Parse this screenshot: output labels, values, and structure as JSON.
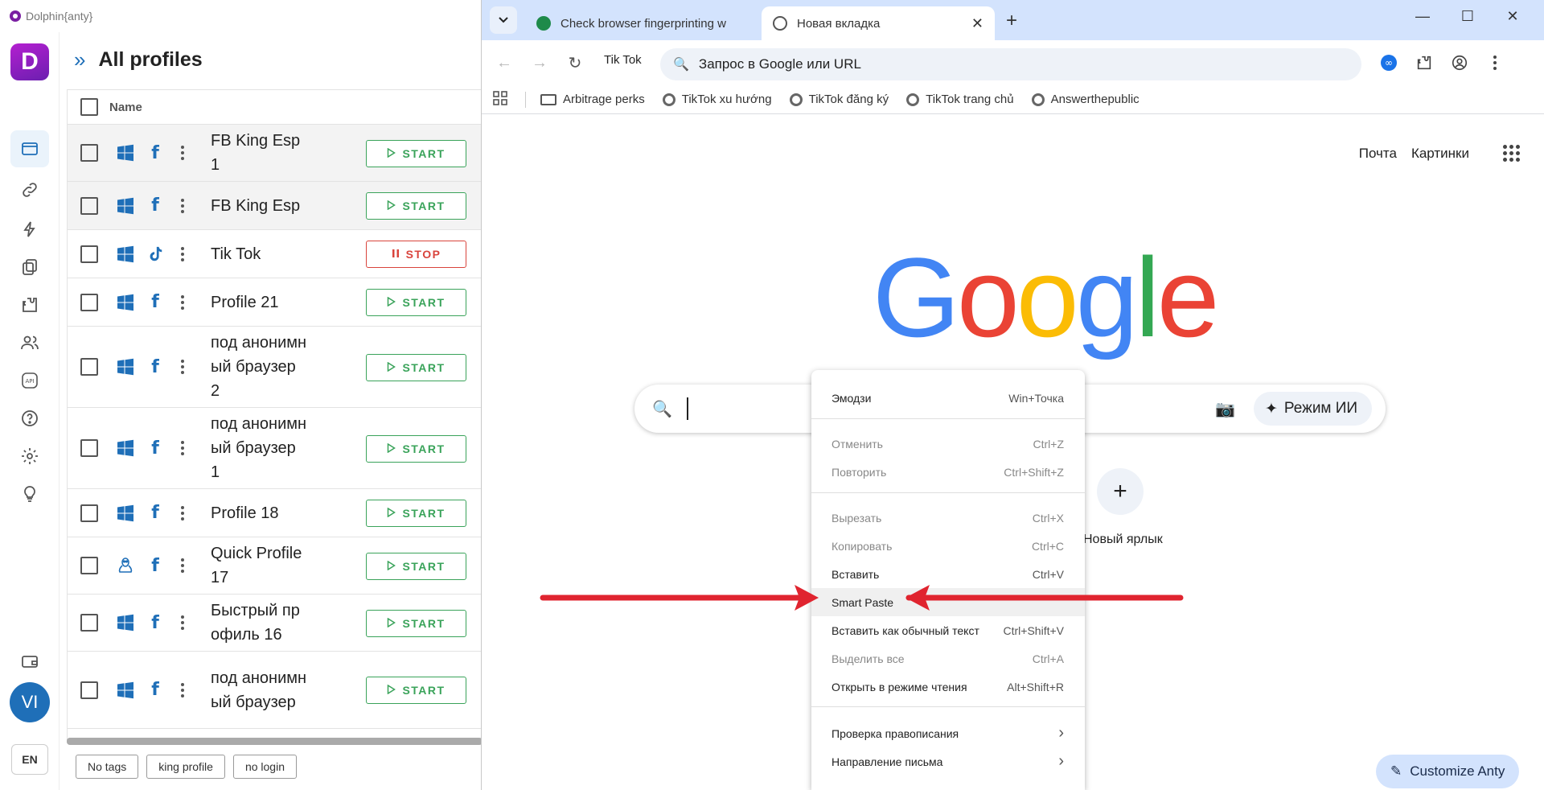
{
  "dolphin": {
    "app_title": "Dolphin{anty}",
    "logo_letter": "D",
    "page_title": "All profiles",
    "column_name": "Name",
    "avatar_initials": "VI",
    "language": "EN",
    "profiles": [
      {
        "name": "FB King Esp 1",
        "os": "windows",
        "app": "f",
        "action": "START"
      },
      {
        "name": "FB King Esp",
        "os": "windows",
        "app": "f",
        "action": "START"
      },
      {
        "name": "Tik Tok",
        "os": "windows",
        "app": "tiktok",
        "action": "STOP"
      },
      {
        "name": "Profile 21",
        "os": "windows",
        "app": "f",
        "action": "START"
      },
      {
        "name": "под анонимный браузер 2",
        "os": "windows",
        "app": "f",
        "action": "START"
      },
      {
        "name": "под анонимный браузер 1",
        "os": "windows",
        "app": "f",
        "action": "START"
      },
      {
        "name": "Profile 18",
        "os": "windows",
        "app": "f",
        "action": "START"
      },
      {
        "name": "Quick Profile 17",
        "os": "linux",
        "app": "f",
        "action": "START"
      },
      {
        "name": "Быстрый профиль 16",
        "os": "windows",
        "app": "f",
        "action": "START"
      },
      {
        "name": "под анонимный браузер",
        "os": "windows",
        "app": "f",
        "action": "START"
      }
    ],
    "tags": [
      "No tags",
      "king profile",
      "no login"
    ]
  },
  "chrome": {
    "tabs": [
      {
        "title": "Check browser fingerprinting w",
        "active": false
      },
      {
        "title": "Новая вкладка",
        "active": true
      }
    ],
    "profile_chip": "Tik Tok",
    "omnibox_placeholder": "Запрос в Google или URL",
    "bookmarks": [
      "Arbitrage perks",
      "TikTok xu hướng",
      "TikTok đăng ký",
      "TikTok trang chủ",
      "Answerthepublic"
    ],
    "ntp_links": {
      "mail": "Почта",
      "images": "Картинки"
    },
    "logo": {
      "l1": "G",
      "l2": "o",
      "l3": "o",
      "l4": "g",
      "l5": "l",
      "l6": "e"
    },
    "ai_mode_label": "Режим ИИ",
    "shortcut_label": "Новый ярлык",
    "customize_label": "Customize Anty"
  },
  "context_menu": {
    "items": [
      {
        "label": "Эмодзи",
        "shortcut": "Win+Точка",
        "enabled": true
      },
      {
        "label": "Отменить",
        "shortcut": "Ctrl+Z",
        "enabled": false
      },
      {
        "label": "Повторить",
        "shortcut": "Ctrl+Shift+Z",
        "enabled": false
      },
      {
        "label": "Вырезать",
        "shortcut": "Ctrl+X",
        "enabled": false
      },
      {
        "label": "Копировать",
        "shortcut": "Ctrl+C",
        "enabled": false
      },
      {
        "label": "Вставить",
        "shortcut": "Ctrl+V",
        "enabled": true
      },
      {
        "label": "Smart Paste",
        "shortcut": "",
        "enabled": true,
        "highlighted": true
      },
      {
        "label": "Вставить как обычный текст",
        "shortcut": "Ctrl+Shift+V",
        "enabled": true
      },
      {
        "label": "Выделить все",
        "shortcut": "Ctrl+A",
        "enabled": false
      },
      {
        "label": "Открыть в режиме чтения",
        "shortcut": "Alt+Shift+R",
        "enabled": true
      },
      {
        "label": "Проверка правописания",
        "shortcut": "›",
        "enabled": true
      },
      {
        "label": "Направление письма",
        "shortcut": "›",
        "enabled": true
      }
    ]
  },
  "colors": {
    "accent_blue": "#1f6fb8",
    "start_green": "#3aa35a",
    "stop_red": "#d9443c",
    "arrow_red": "#e0242f"
  }
}
